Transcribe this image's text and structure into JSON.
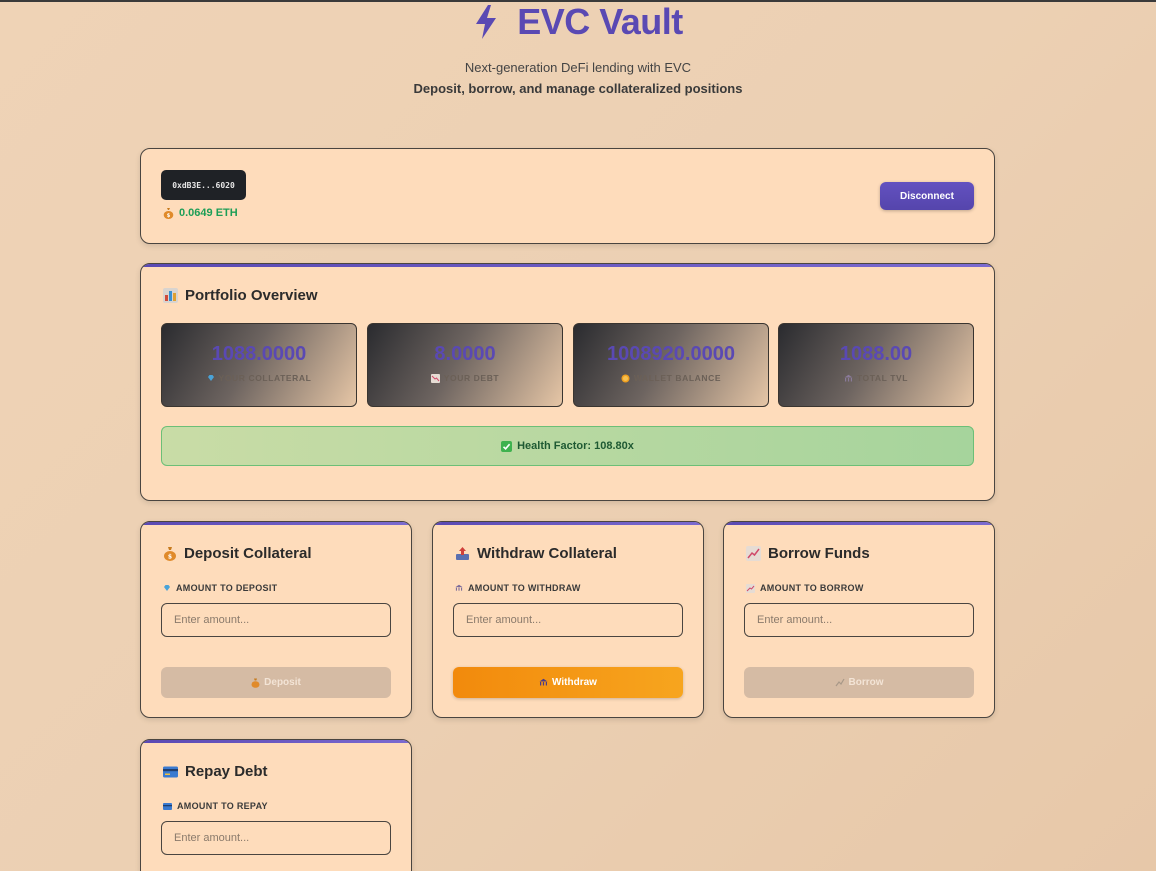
{
  "app": {
    "title": "EVC Vault",
    "subtitle": "Next-generation DeFi lending with EVC",
    "tagline": "Deposit, borrow, and manage collateralized positions",
    "brand_color": "#5a49b3",
    "icon": "lightning-bolt-icon"
  },
  "wallet": {
    "address": "0xdB3E...6020",
    "balance": "0.0649 ETH",
    "balance_icon": "money-bag-icon",
    "disconnect_label": "Disconnect"
  },
  "portfolio": {
    "title": "Portfolio Overview",
    "title_icon": "bar-chart-icon",
    "stats": [
      {
        "value": "1088.0000",
        "label": "YOUR COLLATERAL",
        "icon": "gem-icon"
      },
      {
        "value": "8.0000",
        "label": "YOUR DEBT",
        "icon": "chart-decreasing-icon"
      },
      {
        "value": "1008920.0000",
        "label": "WALLET BALANCE",
        "icon": "coin-icon"
      },
      {
        "value": "1088.00",
        "label": "TOTAL TVL",
        "icon": "bank-icon"
      }
    ],
    "health": {
      "text": "Health Factor: 108.80x",
      "icon": "check-mark-icon",
      "status_color": "#1f5a33"
    }
  },
  "actions": [
    {
      "title": "Deposit Collateral",
      "title_icon": "money-bag-icon",
      "field_label": "AMOUNT TO DEPOSIT",
      "field_icon": "gem-icon",
      "placeholder": "Enter amount...",
      "button_label": "Deposit",
      "button_icon": "money-bag-icon",
      "button_state": "disabled"
    },
    {
      "title": "Withdraw Collateral",
      "title_icon": "outbox-icon",
      "field_label": "AMOUNT TO WITHDRAW",
      "field_icon": "bank-icon",
      "placeholder": "Enter amount...",
      "button_label": "Withdraw",
      "button_icon": "bank-icon",
      "button_state": "active"
    },
    {
      "title": "Borrow Funds",
      "title_icon": "chart-increasing-icon",
      "field_label": "AMOUNT TO BORROW",
      "field_icon": "chart-increasing-icon",
      "placeholder": "Enter amount...",
      "button_label": "Borrow",
      "button_icon": "chart-increasing-icon",
      "button_state": "disabled"
    },
    {
      "title": "Repay Debt",
      "title_icon": "credit-card-icon",
      "field_label": "AMOUNT TO REPAY",
      "field_icon": "credit-card-icon",
      "placeholder": "Enter amount..."
    }
  ]
}
